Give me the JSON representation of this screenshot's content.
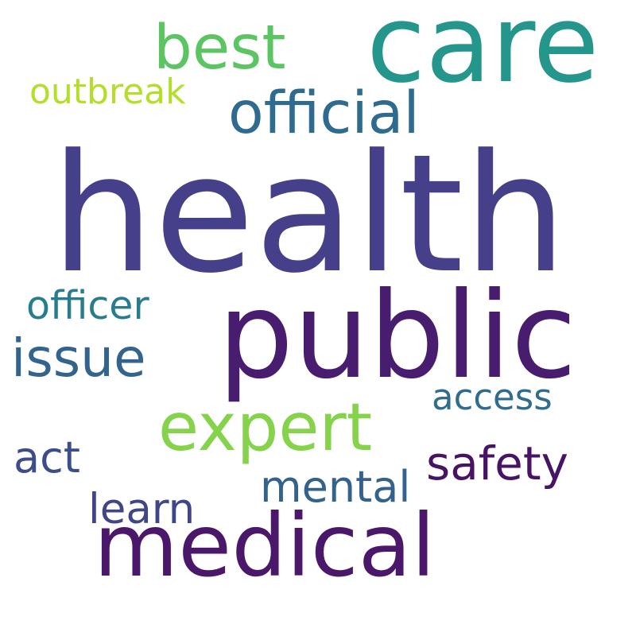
{
  "words": [
    {
      "id": "health",
      "text": "health",
      "color": "#46408a"
    },
    {
      "id": "care",
      "text": "care",
      "color": "#24968b"
    },
    {
      "id": "public",
      "text": "public",
      "color": "#481c6e"
    },
    {
      "id": "medical",
      "text": "medical",
      "color": "#4a176a"
    },
    {
      "id": "expert",
      "text": "expert",
      "color": "#84d34b"
    },
    {
      "id": "best",
      "text": "best",
      "color": "#5cc563"
    },
    {
      "id": "official",
      "text": "official",
      "color": "#2e6b8e"
    },
    {
      "id": "issue",
      "text": "issue",
      "color": "#32648e"
    },
    {
      "id": "officer",
      "text": "officer",
      "color": "#277d8e"
    },
    {
      "id": "outbreak",
      "text": "outbreak",
      "color": "#b5de2b"
    },
    {
      "id": "access",
      "text": "access",
      "color": "#2f6c8e"
    },
    {
      "id": "safety",
      "text": "safety",
      "color": "#471365"
    },
    {
      "id": "act",
      "text": "act",
      "color": "#3d4d8a"
    },
    {
      "id": "mental",
      "text": "mental",
      "color": "#33638d"
    },
    {
      "id": "learn",
      "text": "learn",
      "color": "#404588"
    }
  ]
}
